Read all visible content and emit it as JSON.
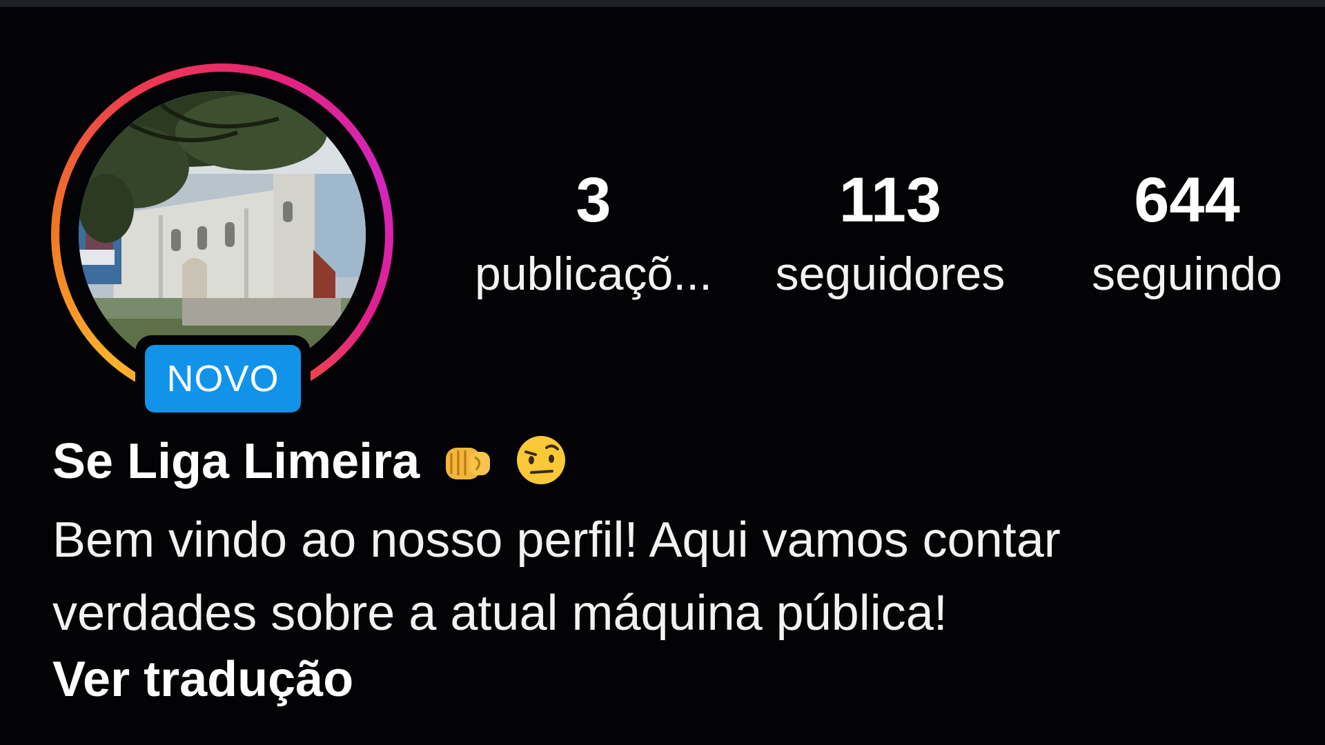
{
  "profile": {
    "new_badge": "NOVO",
    "name": "Se Liga Limeira",
    "name_emojis": [
      "oncoming-fist-icon",
      "face-with-raised-eyebrow-icon"
    ],
    "bio_lines": [
      "Bem vindo ao nosso perfil! Aqui vamos contar",
      "verdades sobre a atual máquina pública!"
    ],
    "translate_link": "Ver tradução"
  },
  "stats": {
    "posts": {
      "count": "3",
      "label": "publicaçõ..."
    },
    "followers": {
      "count": "113",
      "label": "seguidores"
    },
    "following": {
      "count": "644",
      "label": "seguindo"
    }
  },
  "colors": {
    "background": "#030306",
    "text": "#ffffff",
    "badge": "#1193ea",
    "story_ring_start": "#ff9b1a",
    "story_ring_end": "#d326c0"
  }
}
